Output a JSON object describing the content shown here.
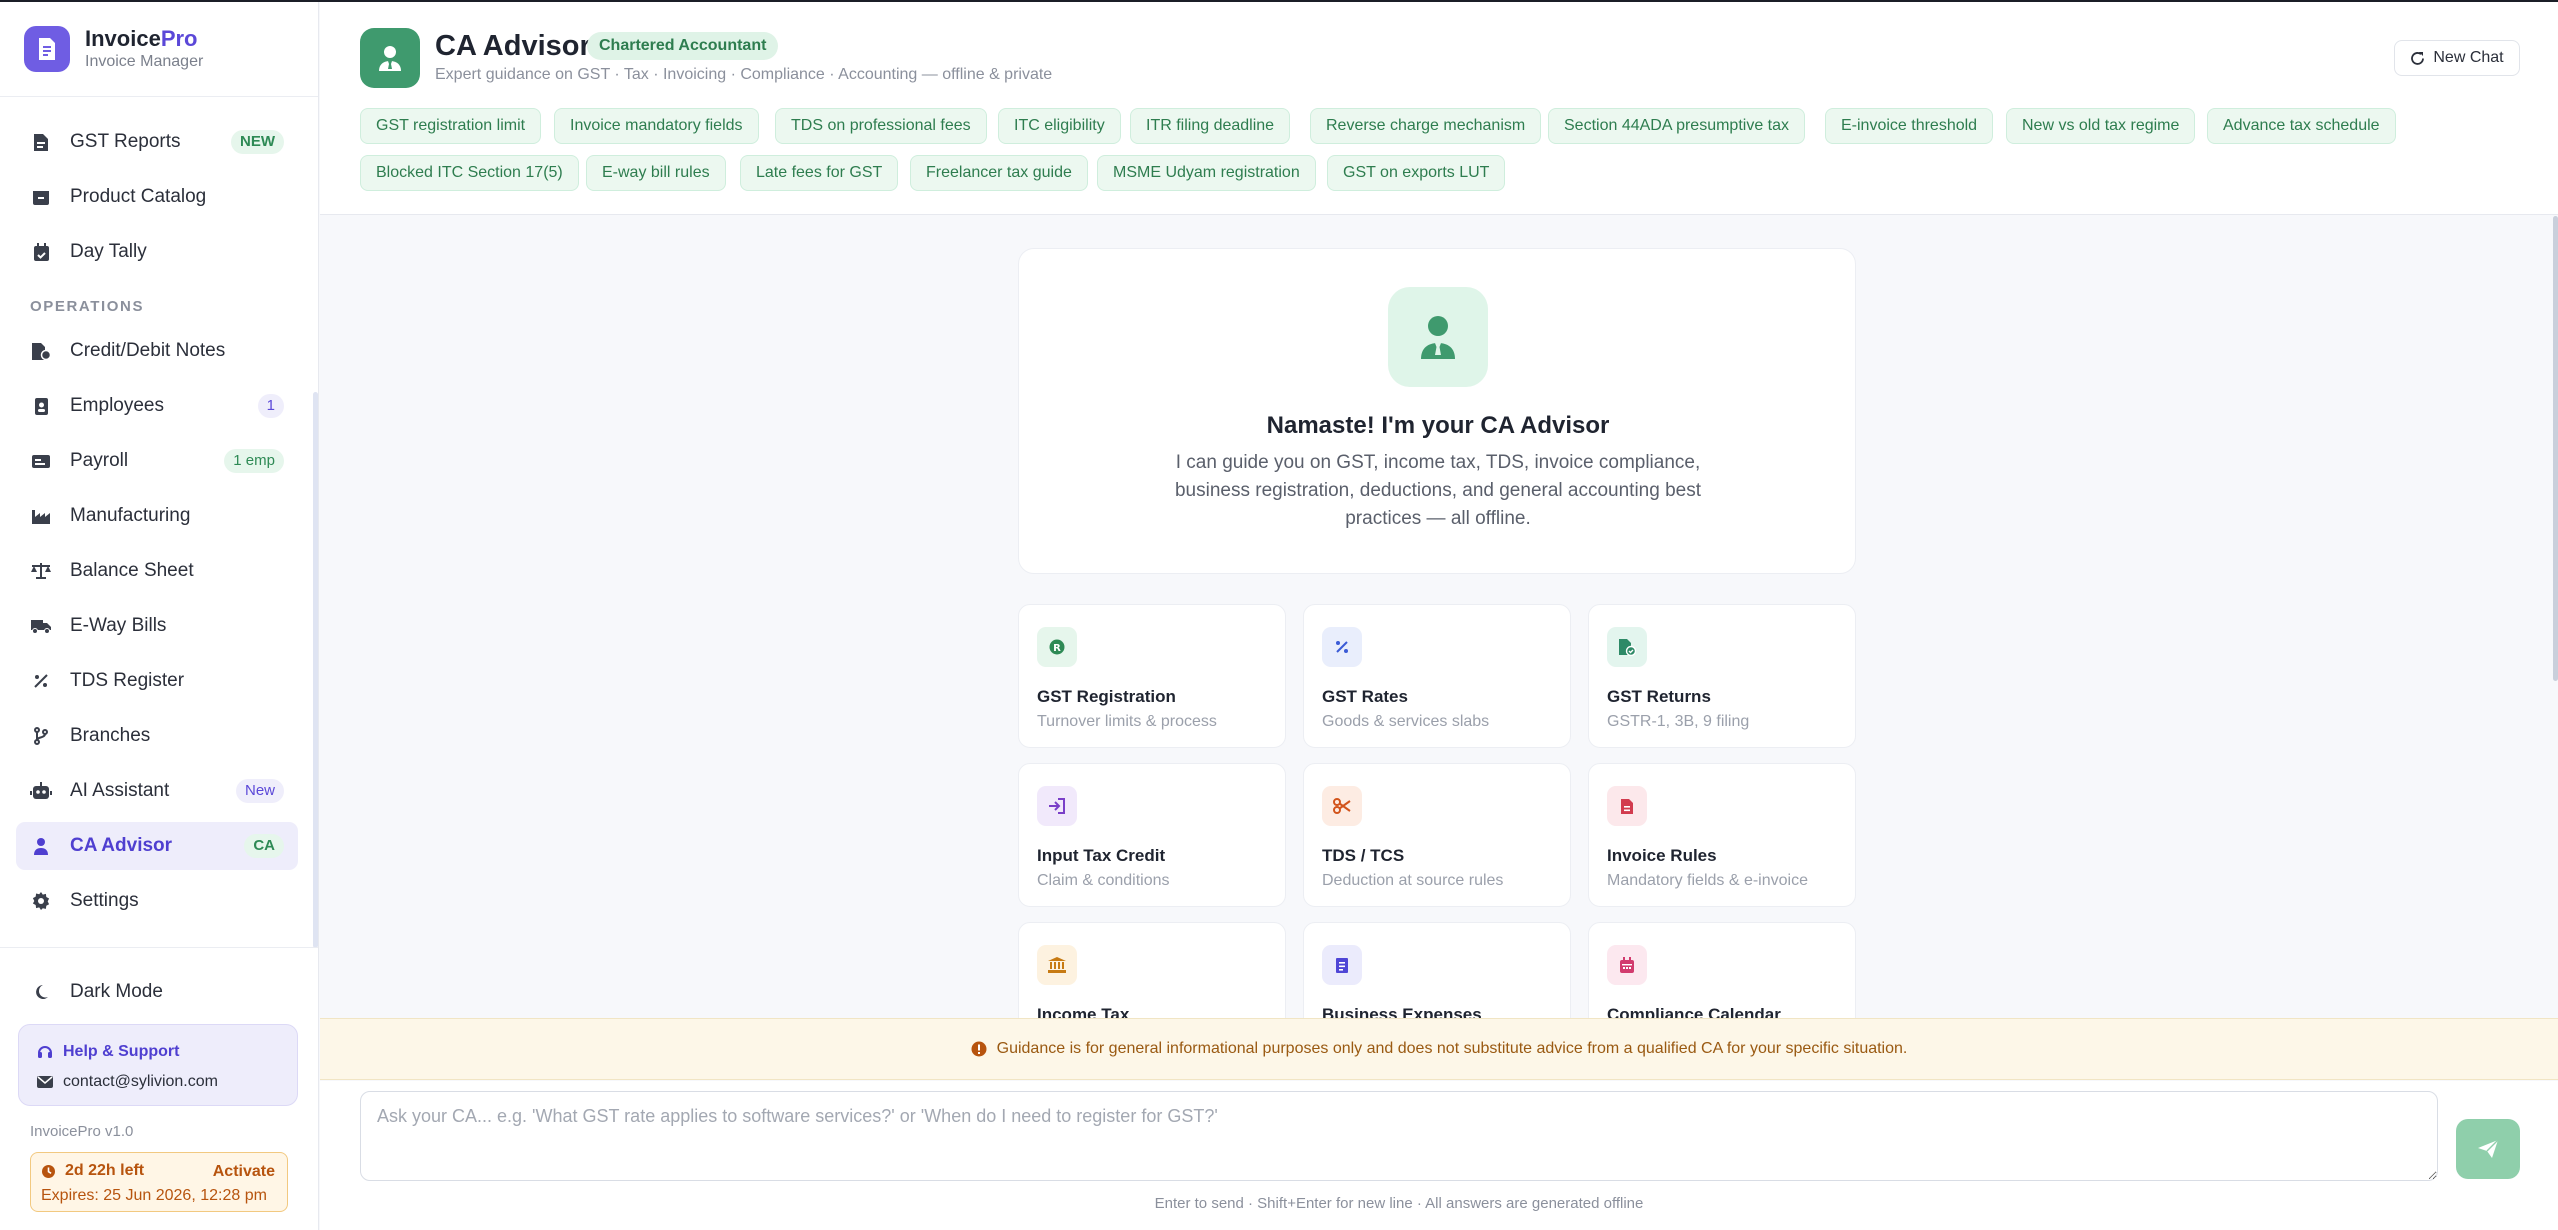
{
  "brand": {
    "name_main": "Invoice",
    "name_accent": "Pro",
    "subtitle": "Invoice Manager"
  },
  "sidebar": {
    "items": [
      {
        "label": "GST Reports",
        "badge": "NEW",
        "icon": "report-icon"
      },
      {
        "label": "Product Catalog",
        "badge": "",
        "icon": "box-icon"
      },
      {
        "label": "Day Tally",
        "badge": "",
        "icon": "calendar-check-icon"
      }
    ],
    "section_label": "OPERATIONS",
    "ops_items": [
      {
        "label": "Credit/Debit Notes",
        "badge": "",
        "icon": "file-invoice-icon"
      },
      {
        "label": "Employees",
        "badge": "1",
        "icon": "id-badge-icon"
      },
      {
        "label": "Payroll",
        "badge": "1 emp",
        "icon": "money-check-icon"
      },
      {
        "label": "Manufacturing",
        "badge": "",
        "icon": "factory-icon"
      },
      {
        "label": "Balance Sheet",
        "badge": "",
        "icon": "scale-icon"
      },
      {
        "label": "E-Way Bills",
        "badge": "",
        "icon": "truck-icon"
      },
      {
        "label": "TDS Register",
        "badge": "",
        "icon": "percent-icon"
      },
      {
        "label": "Branches",
        "badge": "",
        "icon": "branch-icon"
      },
      {
        "label": "AI Assistant",
        "badge": "New",
        "icon": "robot-icon"
      },
      {
        "label": "CA Advisor",
        "badge": "CA",
        "icon": "user-tie-icon",
        "active": true
      },
      {
        "label": "Settings",
        "badge": "",
        "icon": "gear-icon"
      }
    ],
    "dark_mode": "Dark Mode",
    "help": {
      "title": "Help & Support",
      "email": "contact@sylivion.com"
    },
    "version": "InvoicePro v1.0",
    "trial": {
      "left": "2d 22h left",
      "activate": "Activate",
      "expires": "Expires: 25 Jun 2026, 12:28 pm"
    }
  },
  "header": {
    "title": "CA Advisor",
    "badge": "Chartered Accountant",
    "subtitle": "Expert guidance on GST · Tax · Invoicing · Compliance · Accounting — offline & private",
    "new_chat": "New Chat",
    "chips": [
      "GST registration limit",
      "Invoice mandatory fields",
      "TDS on professional fees",
      "ITC eligibility",
      "ITR filing deadline",
      "Reverse charge mechanism",
      "Section 44ADA presumptive tax",
      "E-invoice threshold",
      "New vs old tax regime",
      "Advance tax schedule",
      "Blocked ITC Section 17(5)",
      "E-way bill rules",
      "Late fees for GST",
      "Freelancer tax guide",
      "MSME Udyam registration",
      "GST on exports LUT"
    ]
  },
  "welcome": {
    "title": "Namaste! I'm your CA Advisor",
    "text": "I can guide you on GST, income tax, TDS, invoice compliance, business registration, deductions, and general accounting best practices — all offline."
  },
  "cards": [
    {
      "title": "GST Registration",
      "sub": "Turnover limits & process",
      "icon": "registered-icon",
      "color": "#2e8a55",
      "bg": "#e6f6ec"
    },
    {
      "title": "GST Rates",
      "sub": "Goods & services slabs",
      "icon": "percent-icon",
      "color": "#3b5bd6",
      "bg": "#e9eefc"
    },
    {
      "title": "GST Returns",
      "sub": "GSTR-1, 3B, 9 filing",
      "icon": "file-check-icon",
      "color": "#2e8a67",
      "bg": "#e3f5ee"
    },
    {
      "title": "Input Tax Credit",
      "sub": "Claim & conditions",
      "icon": "sign-in-icon",
      "color": "#7a3fc8",
      "bg": "#f1e9fb"
    },
    {
      "title": "TDS / TCS",
      "sub": "Deduction at source rules",
      "icon": "scissors-icon",
      "color": "#d2541c",
      "bg": "#fdece3"
    },
    {
      "title": "Invoice Rules",
      "sub": "Mandatory fields & e-invoice",
      "icon": "document-icon",
      "color": "#d23b4e",
      "bg": "#fce8eb"
    },
    {
      "title": "Income Tax",
      "sub": "",
      "icon": "bank-icon",
      "color": "#c77a12",
      "bg": "#fdf2e0"
    },
    {
      "title": "Business Expenses",
      "sub": "",
      "icon": "receipt-icon",
      "color": "#4f46d6",
      "bg": "#ebebfc"
    },
    {
      "title": "Compliance Calendar",
      "sub": "",
      "icon": "calendar-icon",
      "color": "#d23b6e",
      "bg": "#fce8ef"
    }
  ],
  "disclaimer": "Guidance is for general informational purposes only and does not substitute advice from a qualified CA for your specific situation.",
  "composer": {
    "placeholder": "Ask your CA... e.g. 'What GST rate applies to software services?' or 'When do I need to register for GST?'",
    "hint": "Enter to send · Shift+Enter for new line · All answers are generated offline"
  }
}
